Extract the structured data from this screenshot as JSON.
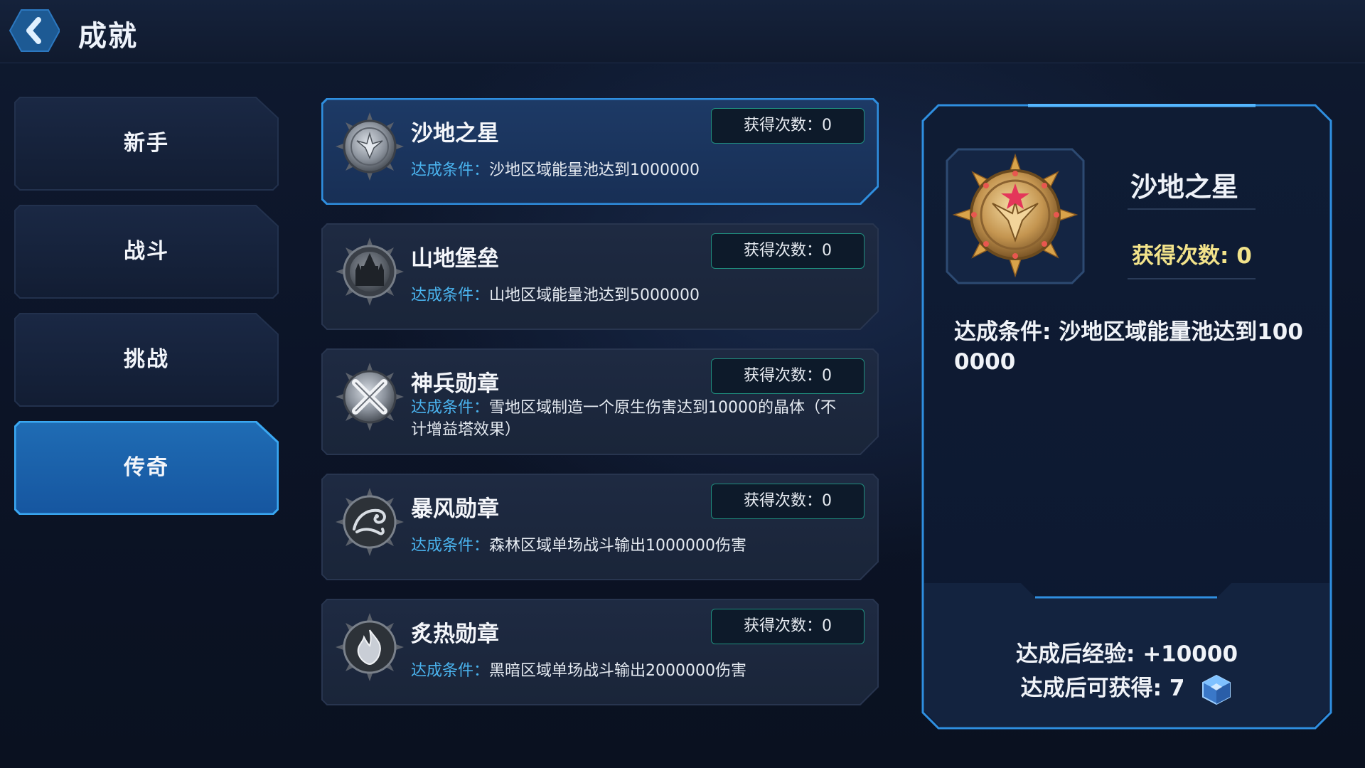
{
  "header": {
    "title": "成就"
  },
  "categories": [
    {
      "label": "新手"
    },
    {
      "label": "战斗"
    },
    {
      "label": "挑战"
    },
    {
      "label": "传奇"
    }
  ],
  "selected_category": "传奇",
  "achievements": [
    {
      "name": "沙地之星",
      "count_text": "获得次数：0",
      "cond_label": "达成条件：",
      "cond_text": "沙地区域能量池达到1000000",
      "medal_icon": "star-wings-medal-icon"
    },
    {
      "name": "山地堡垒",
      "count_text": "获得次数：0",
      "cond_label": "达成条件：",
      "cond_text": "山地区域能量池达到5000000",
      "medal_icon": "fortress-medal-icon"
    },
    {
      "name": "神兵勋章",
      "count_text": "获得次数：0",
      "cond_label": "达成条件：",
      "cond_text": "雪地区域制造一个原生伤害达到10000的晶体（不计增益塔效果）",
      "medal_icon": "crossed-swords-medal-icon"
    },
    {
      "name": "暴风勋章",
      "count_text": "获得次数：0",
      "cond_label": "达成条件：",
      "cond_text": "森林区域单场战斗输出1000000伤害",
      "medal_icon": "storm-dragon-medal-icon"
    },
    {
      "name": "炙热勋章",
      "count_text": "获得次数：0",
      "cond_label": "达成条件：",
      "cond_text": "黑暗区域单场战斗输出2000000伤害",
      "medal_icon": "flame-medal-icon"
    }
  ],
  "detail": {
    "title": "沙地之星",
    "count_label": "获得次数:",
    "count_value": "0",
    "cond_label": "达成条件:",
    "cond_text": "沙地区域能量池达到1000000",
    "exp_label": "达成后经验:",
    "exp_value": "+10000",
    "gain_label": "达成后可获得:",
    "gain_value": "7",
    "reward_icon": "crystal-cube-icon"
  },
  "colors": {
    "accent_blue": "#2f8fe0",
    "condition_label": "#4ab3ee",
    "count_gold": "#f2e38a",
    "badge_border": "#1f8e7e"
  }
}
